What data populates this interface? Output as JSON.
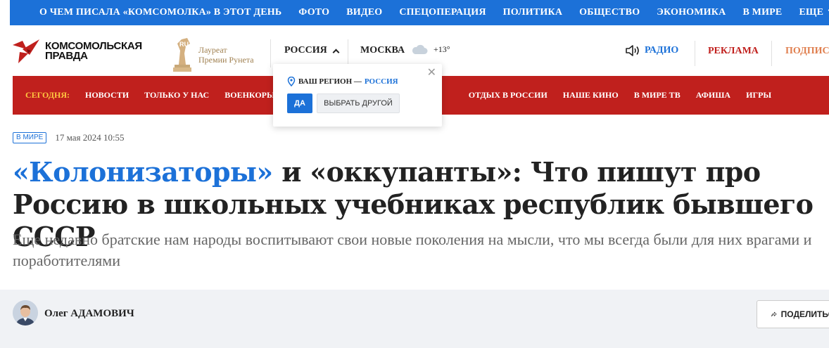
{
  "topnav": {
    "items": [
      "О ЧЕМ ПИСАЛА «КОМСОМОЛКА» В ЭТОТ ДЕНЬ",
      "ФОТО",
      "ВИДЕО",
      "СПЕЦОПЕРАЦИЯ",
      "ПОЛИТИКА",
      "ОБЩЕСТВО",
      "ЭКОНОМИКА",
      "В МИРЕ",
      "ЕЩЕ"
    ]
  },
  "header": {
    "logo_line1": "КОМСОМОЛЬСКАЯ",
    "logo_line2": "ПРАВДА",
    "award_line1": "Лауреат",
    "award_line2": "Премии Рунета",
    "region": "РОССИЯ",
    "city": "МОСКВА",
    "temperature": "+13°",
    "radio": "РАДИО",
    "ads": "РЕКЛАМА",
    "subscribe": "ПОДПИСКА"
  },
  "rednav": {
    "today": "СЕГОДНЯ:",
    "items_left": [
      "НОВОСТИ",
      "ТОЛЬКО У НАС",
      "ВОЕНКОРЫ"
    ],
    "items_right": [
      "ОТДЫХ В РОССИИ",
      "НАШЕ КИНО",
      "В МИРЕ ТВ",
      "АФИША",
      "ИГРЫ"
    ]
  },
  "popup": {
    "label": "ВАШ РЕГИОН —",
    "region": "РОССИЯ",
    "yes": "ДА",
    "other": "ВЫБРАТЬ ДРУГОЙ"
  },
  "article": {
    "rubric": "В МИРЕ",
    "date": "17 мая 2024 10:55",
    "title_blue": "«Колонизаторы»",
    "title_rest": " и «оккупанты»: Что пишут про Россию в школьных учебниках республик бывшего СССР",
    "lead": "Еще недавно братские нам народы воспитывают свои новые поколения на мысли, что мы всегда были для них врагами и поработителями",
    "author": "Олег АДАМОВИЧ",
    "share": "ПОДЕЛИТЬСЯ"
  },
  "colors": {
    "blue": "#1c71d8",
    "red": "#c0201d",
    "yellow": "#ffc640"
  }
}
